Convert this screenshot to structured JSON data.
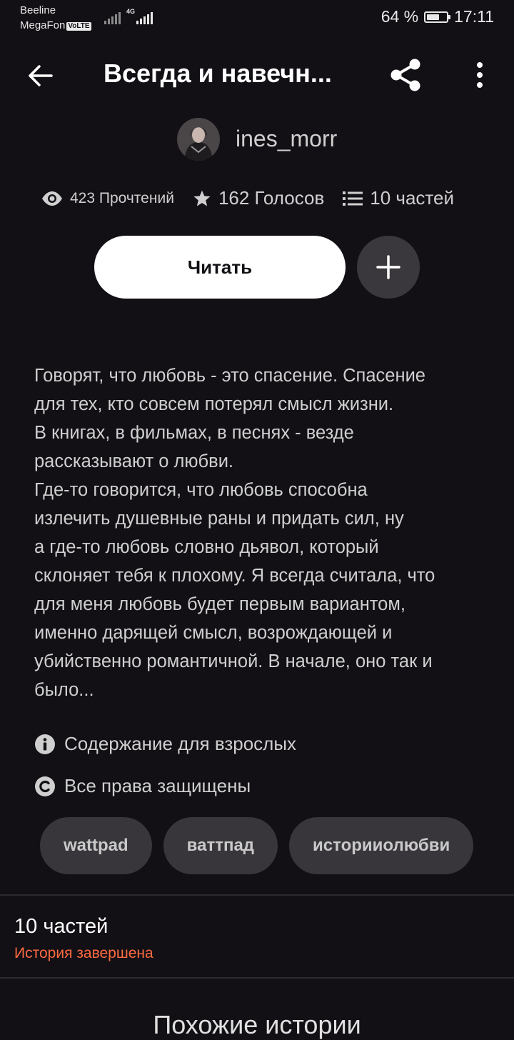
{
  "status_bar": {
    "carrier_1": "Beeline",
    "carrier_2": "MegaFon",
    "volte_badge": "VoLTE",
    "network_type": "4G",
    "battery_percent": "64 %",
    "battery_level": 0.64,
    "time": "17:11"
  },
  "header": {
    "title": "Всегда и навечн...",
    "icons": {
      "back": "arrow-left",
      "share": "share",
      "menu": "more-vertical"
    }
  },
  "author": {
    "username": "ines_morr"
  },
  "stats": {
    "reads": "423 Прочтений",
    "votes": "162 Голосов",
    "parts": "10 частей"
  },
  "actions": {
    "read_label": "Читать",
    "add_icon": "plus"
  },
  "description": [
    "Говорят, что любовь - это спасение. Спасение",
    "для тех, кто совсем потерял смысл жизни.",
    "В книгах, в фильмах, в песнях - везде",
    "рассказывают о любви.",
    "Где-то говорится, что любовь способна",
    "излечить душевные раны и придать сил, ну",
    "а где-то любовь словно дьявол, который",
    "склоняет тебя к плохому. Я всегда считала, что",
    "для меня любовь будет первым вариантом,",
    "именно дарящей смысл, возрождающей и",
    "убийственно романтичной. В начале, оно так и",
    "было..."
  ],
  "notices": {
    "mature": "Содержание для взрослых",
    "copyright": "Все права защищены"
  },
  "tags": [
    "wattpad",
    "ваттпад",
    "историиолюбви"
  ],
  "table_of_contents": {
    "parts_title": "10 частей",
    "status": "История завершена"
  },
  "similar_stories": {
    "title": "Похожие истории"
  },
  "colors": {
    "background": "#121015",
    "accent": "#ff6b40",
    "button": "#ffffff"
  }
}
